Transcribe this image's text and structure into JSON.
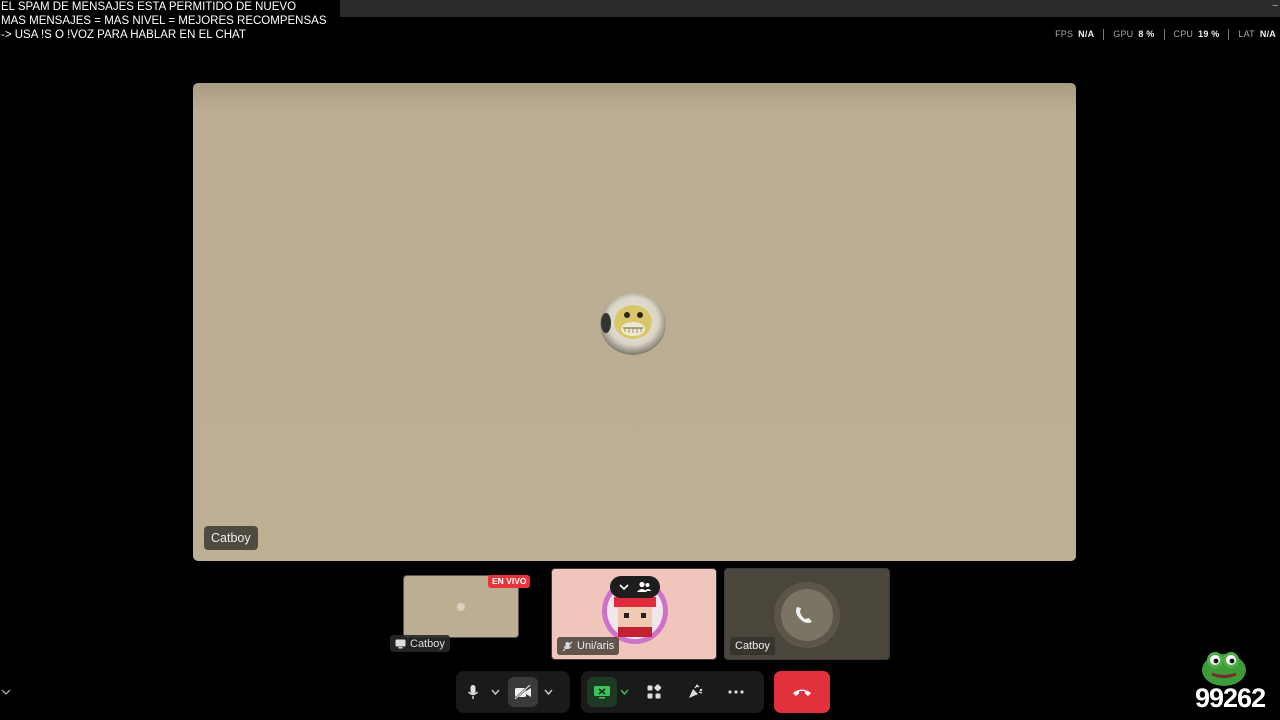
{
  "overlay": {
    "lines": [
      "EL SPAM DE MENSAJES ESTA PERMITIDO DE NUEVO",
      "MAS MENSAJES = MAS NIVEL = MEJORES RECOMPENSAS",
      "-> USA !S  O !VOZ PARA HABLAR EN EL CHAT"
    ]
  },
  "stats": {
    "fps_label": "FPS",
    "fps_value": "N/A",
    "gpu_label": "GPU",
    "gpu_value": "8 %",
    "cpu_label": "CPU",
    "cpu_value": "19 %",
    "lat_label": "LAT",
    "lat_value": "N/A"
  },
  "main_video": {
    "name": "Catboy",
    "background_color": "#bcae93"
  },
  "participants": [
    {
      "name": "Catboy",
      "badge": "EN VIVO",
      "icon": "screen-share-icon"
    },
    {
      "name": "Uni/aris",
      "icon": "mic-off-icon"
    },
    {
      "name": "Catboy",
      "icon": "phone-icon"
    }
  ],
  "controls": {
    "mic": "mic-icon",
    "camera": "camera-off-icon",
    "share": "screen-share-icon",
    "apps": "apps-icon",
    "reactions": "reactions-icon",
    "more": "more-icon",
    "end_call": "hang-up-icon",
    "end_call_color": "#e3303d"
  },
  "counter": {
    "value": "99262"
  }
}
